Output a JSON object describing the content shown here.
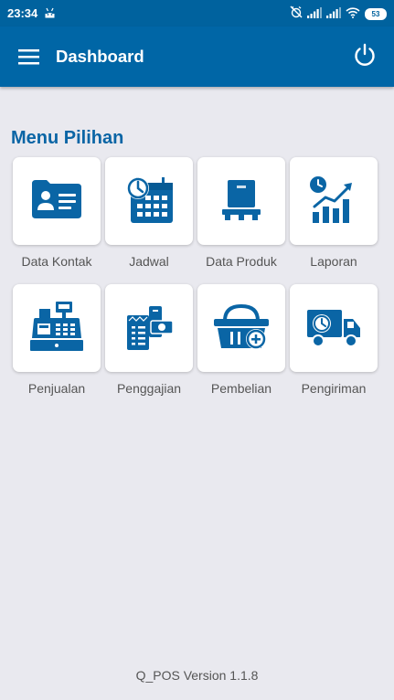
{
  "status_bar": {
    "time": "23:34",
    "battery": "53",
    "icons": [
      "android-icon",
      "alarm-off-icon",
      "signal-icon",
      "signal-icon",
      "wifi-icon",
      "battery-icon"
    ]
  },
  "app_bar": {
    "title": "Dashboard",
    "menu_icon": "hamburger-icon",
    "power_icon": "power-icon"
  },
  "section": {
    "title": "Menu Pilihan"
  },
  "menu": [
    {
      "label": "Data Kontak",
      "icon": "contact-card-icon"
    },
    {
      "label": "Jadwal",
      "icon": "calendar-clock-icon"
    },
    {
      "label": "Data Produk",
      "icon": "product-box-icon"
    },
    {
      "label": "Laporan",
      "icon": "report-chart-icon"
    },
    {
      "label": "Penjualan",
      "icon": "cash-register-icon"
    },
    {
      "label": "Penggajian",
      "icon": "payroll-icon"
    },
    {
      "label": "Pembelian",
      "icon": "purchase-basket-icon"
    },
    {
      "label": "Pengiriman",
      "icon": "delivery-truck-icon"
    }
  ],
  "footer": {
    "version": "Q_POS Version 1.1.8"
  },
  "colors": {
    "primary": "#0066a6",
    "status_bar": "#00629e",
    "accent_text": "#0a65a5",
    "background": "#e9e9ef"
  }
}
